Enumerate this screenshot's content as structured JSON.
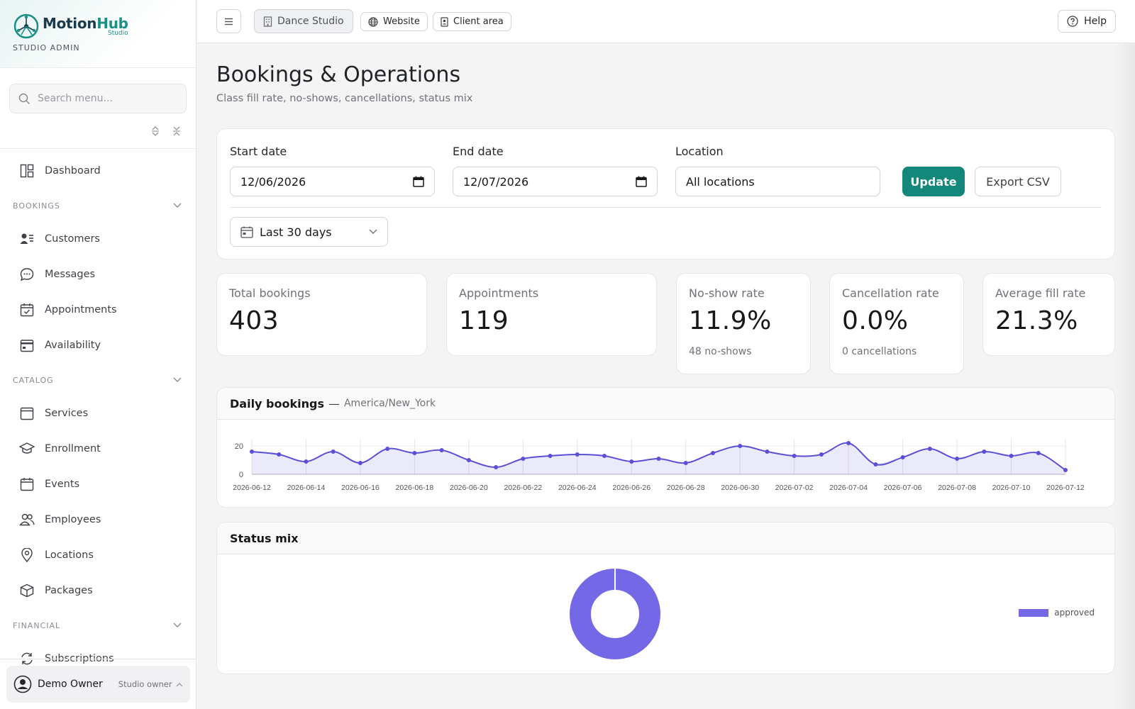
{
  "brand": {
    "name_main": "Motion",
    "name_accent": "Hub",
    "name_sub": "Studio",
    "caption": "STUDIO ADMIN",
    "accent_color": "#1a8f86"
  },
  "sidebar": {
    "search_placeholder": "Search menu...",
    "dashboard_label": "Dashboard",
    "sections": [
      {
        "title": "BOOKINGS",
        "items": [
          "Customers",
          "Messages",
          "Appointments",
          "Availability"
        ]
      },
      {
        "title": "CATALOG",
        "items": [
          "Services",
          "Enrollment",
          "Events",
          "Employees",
          "Locations",
          "Packages"
        ]
      },
      {
        "title": "FINANCIAL",
        "items": [
          "Subscriptions"
        ]
      }
    ],
    "user": {
      "name": "Demo Owner",
      "role": "Studio owner"
    }
  },
  "topbar": {
    "studio_label": "Dance Studio",
    "website_label": "Website",
    "client_label": "Client area",
    "help_label": "Help"
  },
  "page": {
    "title": "Bookings & Operations",
    "subtitle": "Class fill rate, no-shows, cancellations, status mix"
  },
  "filters": {
    "start_label": "Start date",
    "start_value": "12/06/2026",
    "end_label": "End date",
    "end_value": "12/07/2026",
    "location_label": "Location",
    "location_value": "All locations",
    "update_label": "Update",
    "export_label": "Export CSV",
    "range_value": "Last 30 days",
    "primary_color": "#12877a"
  },
  "stats": [
    {
      "label": "Total bookings",
      "value": "403",
      "note": ""
    },
    {
      "label": "Appointments",
      "value": "119",
      "note": ""
    },
    {
      "label": "No-show rate",
      "value": "11.9%",
      "note": "48 no-shows"
    },
    {
      "label": "Cancellation rate",
      "value": "0.0%",
      "note": "0 cancellations"
    },
    {
      "label": "Average fill rate",
      "value": "21.3%",
      "note": ""
    }
  ],
  "daily": {
    "title": "Daily bookings",
    "dash": "—",
    "timezone": "America/New_York"
  },
  "status": {
    "title": "Status mix"
  },
  "chart_data": [
    {
      "type": "area",
      "title": "Daily bookings",
      "ylim": [
        0,
        25
      ],
      "yticks": [
        0,
        20
      ],
      "grid": true,
      "color": "#5b4fd6",
      "x": [
        "2026-06-12",
        "2026-06-13",
        "2026-06-14",
        "2026-06-15",
        "2026-06-16",
        "2026-06-17",
        "2026-06-18",
        "2026-06-19",
        "2026-06-20",
        "2026-06-21",
        "2026-06-22",
        "2026-06-23",
        "2026-06-24",
        "2026-06-25",
        "2026-06-26",
        "2026-06-27",
        "2026-06-28",
        "2026-06-29",
        "2026-06-30",
        "2026-07-01",
        "2026-07-02",
        "2026-07-03",
        "2026-07-04",
        "2026-07-05",
        "2026-07-06",
        "2026-07-07",
        "2026-07-08",
        "2026-07-09",
        "2026-07-10",
        "2026-07-11",
        "2026-07-12"
      ],
      "xticks": [
        "2026-06-12",
        "2026-06-14",
        "2026-06-16",
        "2026-06-18",
        "2026-06-20",
        "2026-06-22",
        "2026-06-24",
        "2026-06-26",
        "2026-06-28",
        "2026-06-30",
        "2026-07-02",
        "2026-07-04",
        "2026-07-06",
        "2026-07-08",
        "2026-07-10",
        "2026-07-12"
      ],
      "values": [
        16,
        14,
        9,
        16,
        8,
        18,
        15,
        17,
        10,
        5,
        11,
        13,
        14,
        13,
        9,
        11,
        8,
        15,
        20,
        16,
        13,
        14,
        22,
        7,
        12,
        18,
        11,
        16,
        13,
        15,
        3
      ]
    },
    {
      "type": "pie",
      "title": "Status mix",
      "donut": true,
      "labels": [
        "approved"
      ],
      "values": [
        100
      ],
      "colors": [
        "#7468e6"
      ],
      "legend": "right"
    }
  ]
}
